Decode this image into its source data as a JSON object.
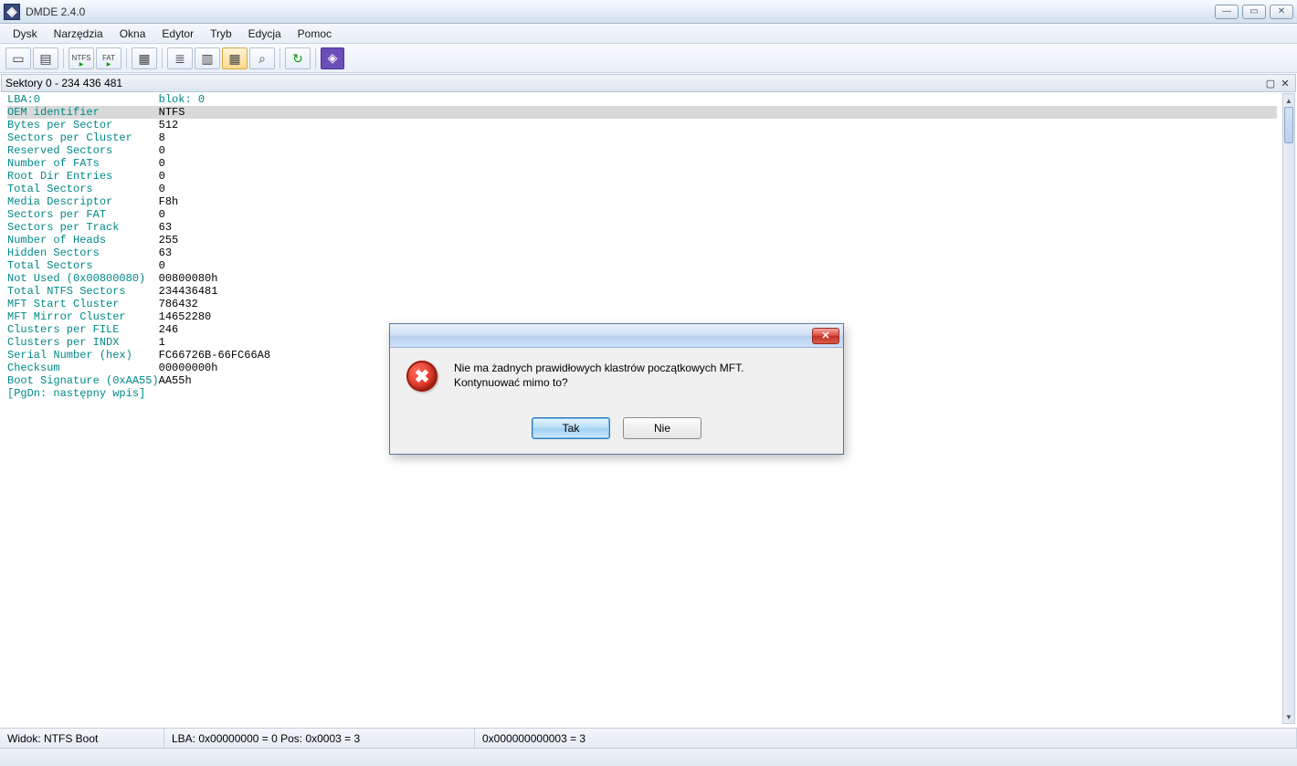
{
  "window": {
    "title": "DMDE 2.4.0"
  },
  "menu": {
    "items": [
      "Dysk",
      "Narzędzia",
      "Okna",
      "Edytor",
      "Tryb",
      "Edycja",
      "Pomoc"
    ]
  },
  "toolbar": {
    "ntfs_label": "NTFS",
    "fat_label": "FAT"
  },
  "sector_header": {
    "text": "Sektory 0 - 234 436 481"
  },
  "header_line": {
    "lba": "LBA:0",
    "blok": "blok: 0"
  },
  "fields": [
    {
      "label": "OEM identifier",
      "value": "NTFS",
      "highlight": true
    },
    {
      "label": "Bytes per Sector",
      "value": "512"
    },
    {
      "label": "Sectors per Cluster",
      "value": "8"
    },
    {
      "label": "Reserved Sectors",
      "value": "0"
    },
    {
      "label": "Number of FATs",
      "value": "0"
    },
    {
      "label": "Root Dir Entries",
      "value": "0"
    },
    {
      "label": "Total Sectors",
      "value": "0"
    },
    {
      "label": "Media Descriptor",
      "value": "F8h"
    },
    {
      "label": "Sectors per FAT",
      "value": "0"
    },
    {
      "label": "Sectors per Track",
      "value": "63"
    },
    {
      "label": "Number of Heads",
      "value": "255"
    },
    {
      "label": "Hidden Sectors",
      "value": "63"
    },
    {
      "label": "Total Sectors",
      "value": "0"
    },
    {
      "label": "Not Used (0x00800080)",
      "value": "00800080h"
    },
    {
      "label": "Total NTFS Sectors",
      "value": "234436481"
    },
    {
      "label": "MFT Start Cluster",
      "value": "786432"
    },
    {
      "label": "MFT Mirror Cluster",
      "value": "14652280"
    },
    {
      "label": "Clusters per FILE",
      "value": "246"
    },
    {
      "label": "Clusters per INDX",
      "value": "1"
    },
    {
      "label": "Serial Number (hex)",
      "value": "FC66726B-66FC66A8"
    },
    {
      "label": "Checksum",
      "value": "00000000h"
    },
    {
      "label": "Boot Signature (0xAA55)",
      "value": "AA55h"
    }
  ],
  "footer_hint": "[PgDn: następny wpis]",
  "status": {
    "view": "Widok: NTFS Boot",
    "lba": "LBA: 0x00000000 = 0  Pos: 0x0003 = 3",
    "offset": "0x000000000003 = 3"
  },
  "dialog": {
    "line1": "Nie ma żadnych prawidłowych klastrów początkowych MFT.",
    "line2": "Kontynuować mimo to?",
    "yes": "Tak",
    "no": "Nie"
  }
}
